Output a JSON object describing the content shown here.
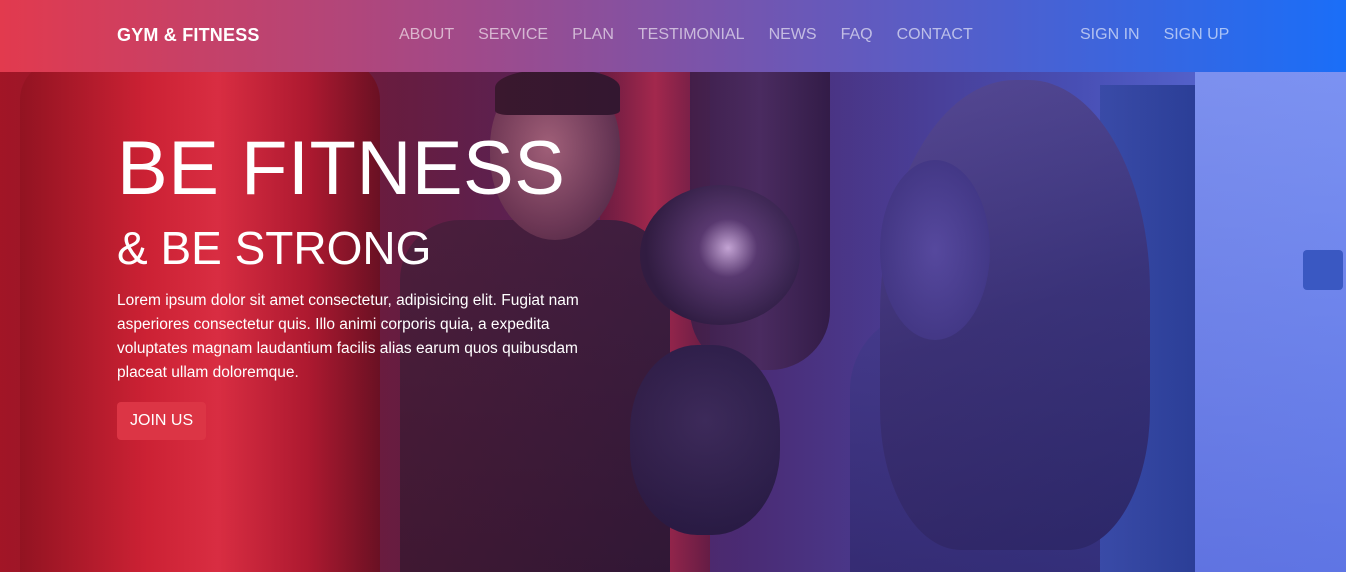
{
  "navbar": {
    "brand": "GYM & FITNESS",
    "links": [
      "ABOUT",
      "SERVICE",
      "PLAN",
      "TESTIMONIAL",
      "NEWS",
      "FAQ",
      "CONTACT"
    ],
    "auth": {
      "sign_in": "SIGN IN",
      "sign_up": "SIGN UP"
    }
  },
  "hero": {
    "title": "BE FITNESS",
    "subtitle": "& BE STRONG",
    "text": "Lorem ipsum dolor sit amet consectetur, adipisicing elit. Fugiat nam asperiores consectetur quis. Illo animi corporis quia, a expedita voluptates magnam laudantium facilis alias earum quos quibusdam placeat ullam doloremque.",
    "cta_label": "JOIN US"
  },
  "colors": {
    "cta": "#dc3545",
    "nav_start": "#e23a4e",
    "nav_end": "#1a6ef8"
  }
}
